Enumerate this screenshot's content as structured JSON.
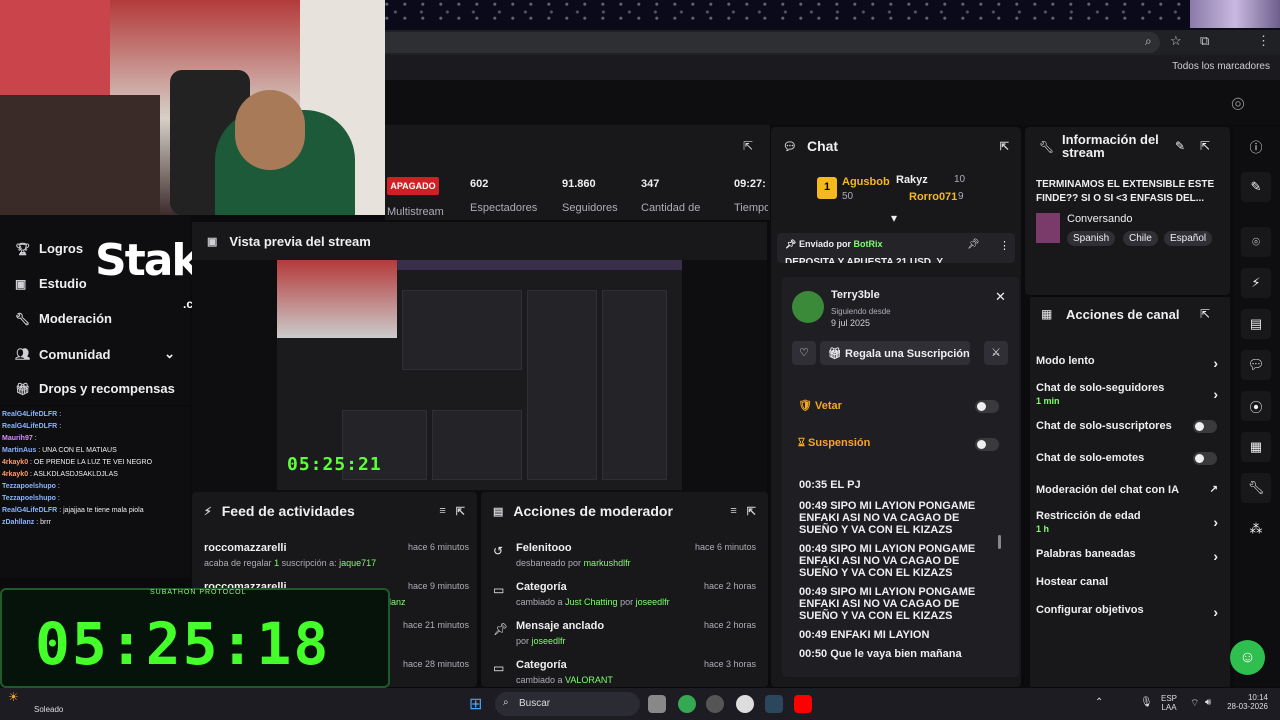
{
  "browser": {
    "bookmarks_label": "Todos los marcadores"
  },
  "sidebar": {
    "items": [
      {
        "label": "Logros",
        "icon": "trophy-icon"
      },
      {
        "label": "Estudio",
        "icon": "studio-icon"
      },
      {
        "label": "Moderación",
        "icon": "wrench-icon"
      },
      {
        "label": "Comunidad",
        "icon": "community-icon"
      },
      {
        "label": "Drops y recompensas",
        "icon": "gift-icon"
      }
    ]
  },
  "overlay": {
    "stake_logo": "Stake",
    "stake_domain": ".com",
    "subathon_title": "SUBATHON PROTOCOL",
    "timer": "05:25:18",
    "preview_timer": "05:25:21"
  },
  "chatlog": [
    {
      "name": "RealG4LifeDLFR",
      "text": ":"
    },
    {
      "name": "RealG4LifeDLFR",
      "text": ":"
    },
    {
      "name": "Maurih97",
      "text": ":"
    },
    {
      "name": "MartinAus",
      "text": ": UNA CON EL MATIAUS"
    },
    {
      "name": "4rkayk0",
      "text": ": OE PRENDE LA LUZ TE VEI NEGRO"
    },
    {
      "name": "4rkayk0",
      "text": ": ASLKDLASDJSAKLDJLAS"
    },
    {
      "name": "Tezzapoelshupo",
      "text": ":"
    },
    {
      "name": "Tezzapoelshupo",
      "text": ":"
    },
    {
      "name": "RealG4LifeDLFR",
      "text": ": jajajjaa te tiene mala piola"
    },
    {
      "name": "zDahllanz",
      "text": ": brrr"
    }
  ],
  "stats": {
    "apagado": "APAGADO",
    "multistream": "Multistream",
    "values": [
      {
        "num": "602",
        "label": "Espectadores"
      },
      {
        "num": "91.860",
        "label": "Seguidores"
      },
      {
        "num": "347",
        "label": "Cantidad de"
      },
      {
        "num": "09:27:",
        "label": "Tiempo"
      }
    ]
  },
  "preview": {
    "title": "Vista previa del stream"
  },
  "feed": {
    "title": "Feed de actividades",
    "items": [
      {
        "user": "roccomazzarelli",
        "time": "hace 6 minutos",
        "pre": "acaba de regalar ",
        "count": "1",
        "mid": " suscripción a: ",
        "target": "jaque717"
      },
      {
        "user": "roccomazzarelli",
        "time": "hace 9 minutos",
        "tail": "lanz"
      },
      {
        "time": "hace 21 minutos"
      },
      {
        "time": "hace 28 minutos"
      }
    ]
  },
  "modactions": {
    "title": "Acciones de moderador",
    "items": [
      {
        "title": "Felenitooo",
        "time": "hace 6 minutos",
        "desc": "desbaneado por ",
        "who": "markushdlfr",
        "icon": "history-icon"
      },
      {
        "title": "Categoría",
        "time": "hace 2 horas",
        "desc": "cambiado a ",
        "who": "Just Chatting",
        "desc2": " por ",
        "who2": "joseedlfr",
        "icon": "category-icon"
      },
      {
        "title": "Mensaje anclado",
        "time": "hace 2 horas",
        "desc": "por ",
        "who": "joseedlfr",
        "icon": "pin-icon"
      },
      {
        "title": "Categoría",
        "time": "hace 3 horas",
        "desc": "cambiado a ",
        "who": "VALORANT",
        "icon": "category-icon"
      }
    ]
  },
  "chat": {
    "title": "Chat",
    "top_gifters": [
      {
        "rank": "1",
        "name": "Agusbob",
        "count": "50"
      },
      {
        "name": "Rakyz",
        "count": "10"
      },
      {
        "name": "Rorro071",
        "count": "9"
      }
    ],
    "pinned_label": "Enviado por",
    "pinned_user": "BotRix",
    "pinned_text": "DEPOSITA Y APUESTA 21 USD, Y"
  },
  "usercard": {
    "name": "Terry3ble",
    "following_label": "Siguiendo desde",
    "following_date": "9 jul 2025",
    "gift_label": "Regala una Suscripción",
    "veto": "Vetar",
    "suspension": "Suspensión",
    "messages": [
      "00:35 EL PJ",
      "00:49 SIPO MI LAYION PONGAME ENFAKI ASI NO VA CAGAO DE SUEÑO Y VA CON EL KIZAZS",
      "00:49 SIPO MI LAYION PONGAME ENFAKI ASI NO VA CAGAO DE SUEÑO Y VA CON EL KIZAZS",
      "00:49 SIPO MI LAYION PONGAME ENFAKI ASI NO VA CAGAO DE SUEÑO Y VA CON EL KIZAZS",
      "00:49 ENFAKI MI LAYION",
      "00:50 Que le vaya bien mañana"
    ]
  },
  "info": {
    "title": "Información del stream",
    "stream_title": "TERMINAMOS EL EXTENSIBLE ESTE FINDE?? SI O SI <3 ENFASIS DEL...",
    "category": "Conversando",
    "tags": [
      "Spanish",
      "Chile",
      "Español"
    ]
  },
  "channel_actions": {
    "title": "Acciones de canal",
    "items": [
      {
        "label": "Modo lento",
        "type": "chevron"
      },
      {
        "label": "Chat de solo-seguidores",
        "sub": "1 min",
        "type": "chevron"
      },
      {
        "label": "Chat de solo-suscriptores",
        "type": "toggle"
      },
      {
        "label": "Chat de solo-emotes",
        "type": "toggle"
      },
      {
        "label": "Moderación del chat con IA",
        "type": "external"
      },
      {
        "label": "Restricción de edad",
        "sub": "1 h",
        "type": "chevron"
      },
      {
        "label": "Palabras baneadas",
        "type": "chevron"
      },
      {
        "label": "Hostear canal",
        "type": "none"
      },
      {
        "label": "Configurar objetivos",
        "type": "chevron"
      }
    ]
  },
  "taskbar": {
    "weather": "Soleado",
    "search": "Buscar",
    "lang1": "ESP",
    "lang2": "LAA",
    "time": "10:14",
    "date": "28-03-2026"
  }
}
